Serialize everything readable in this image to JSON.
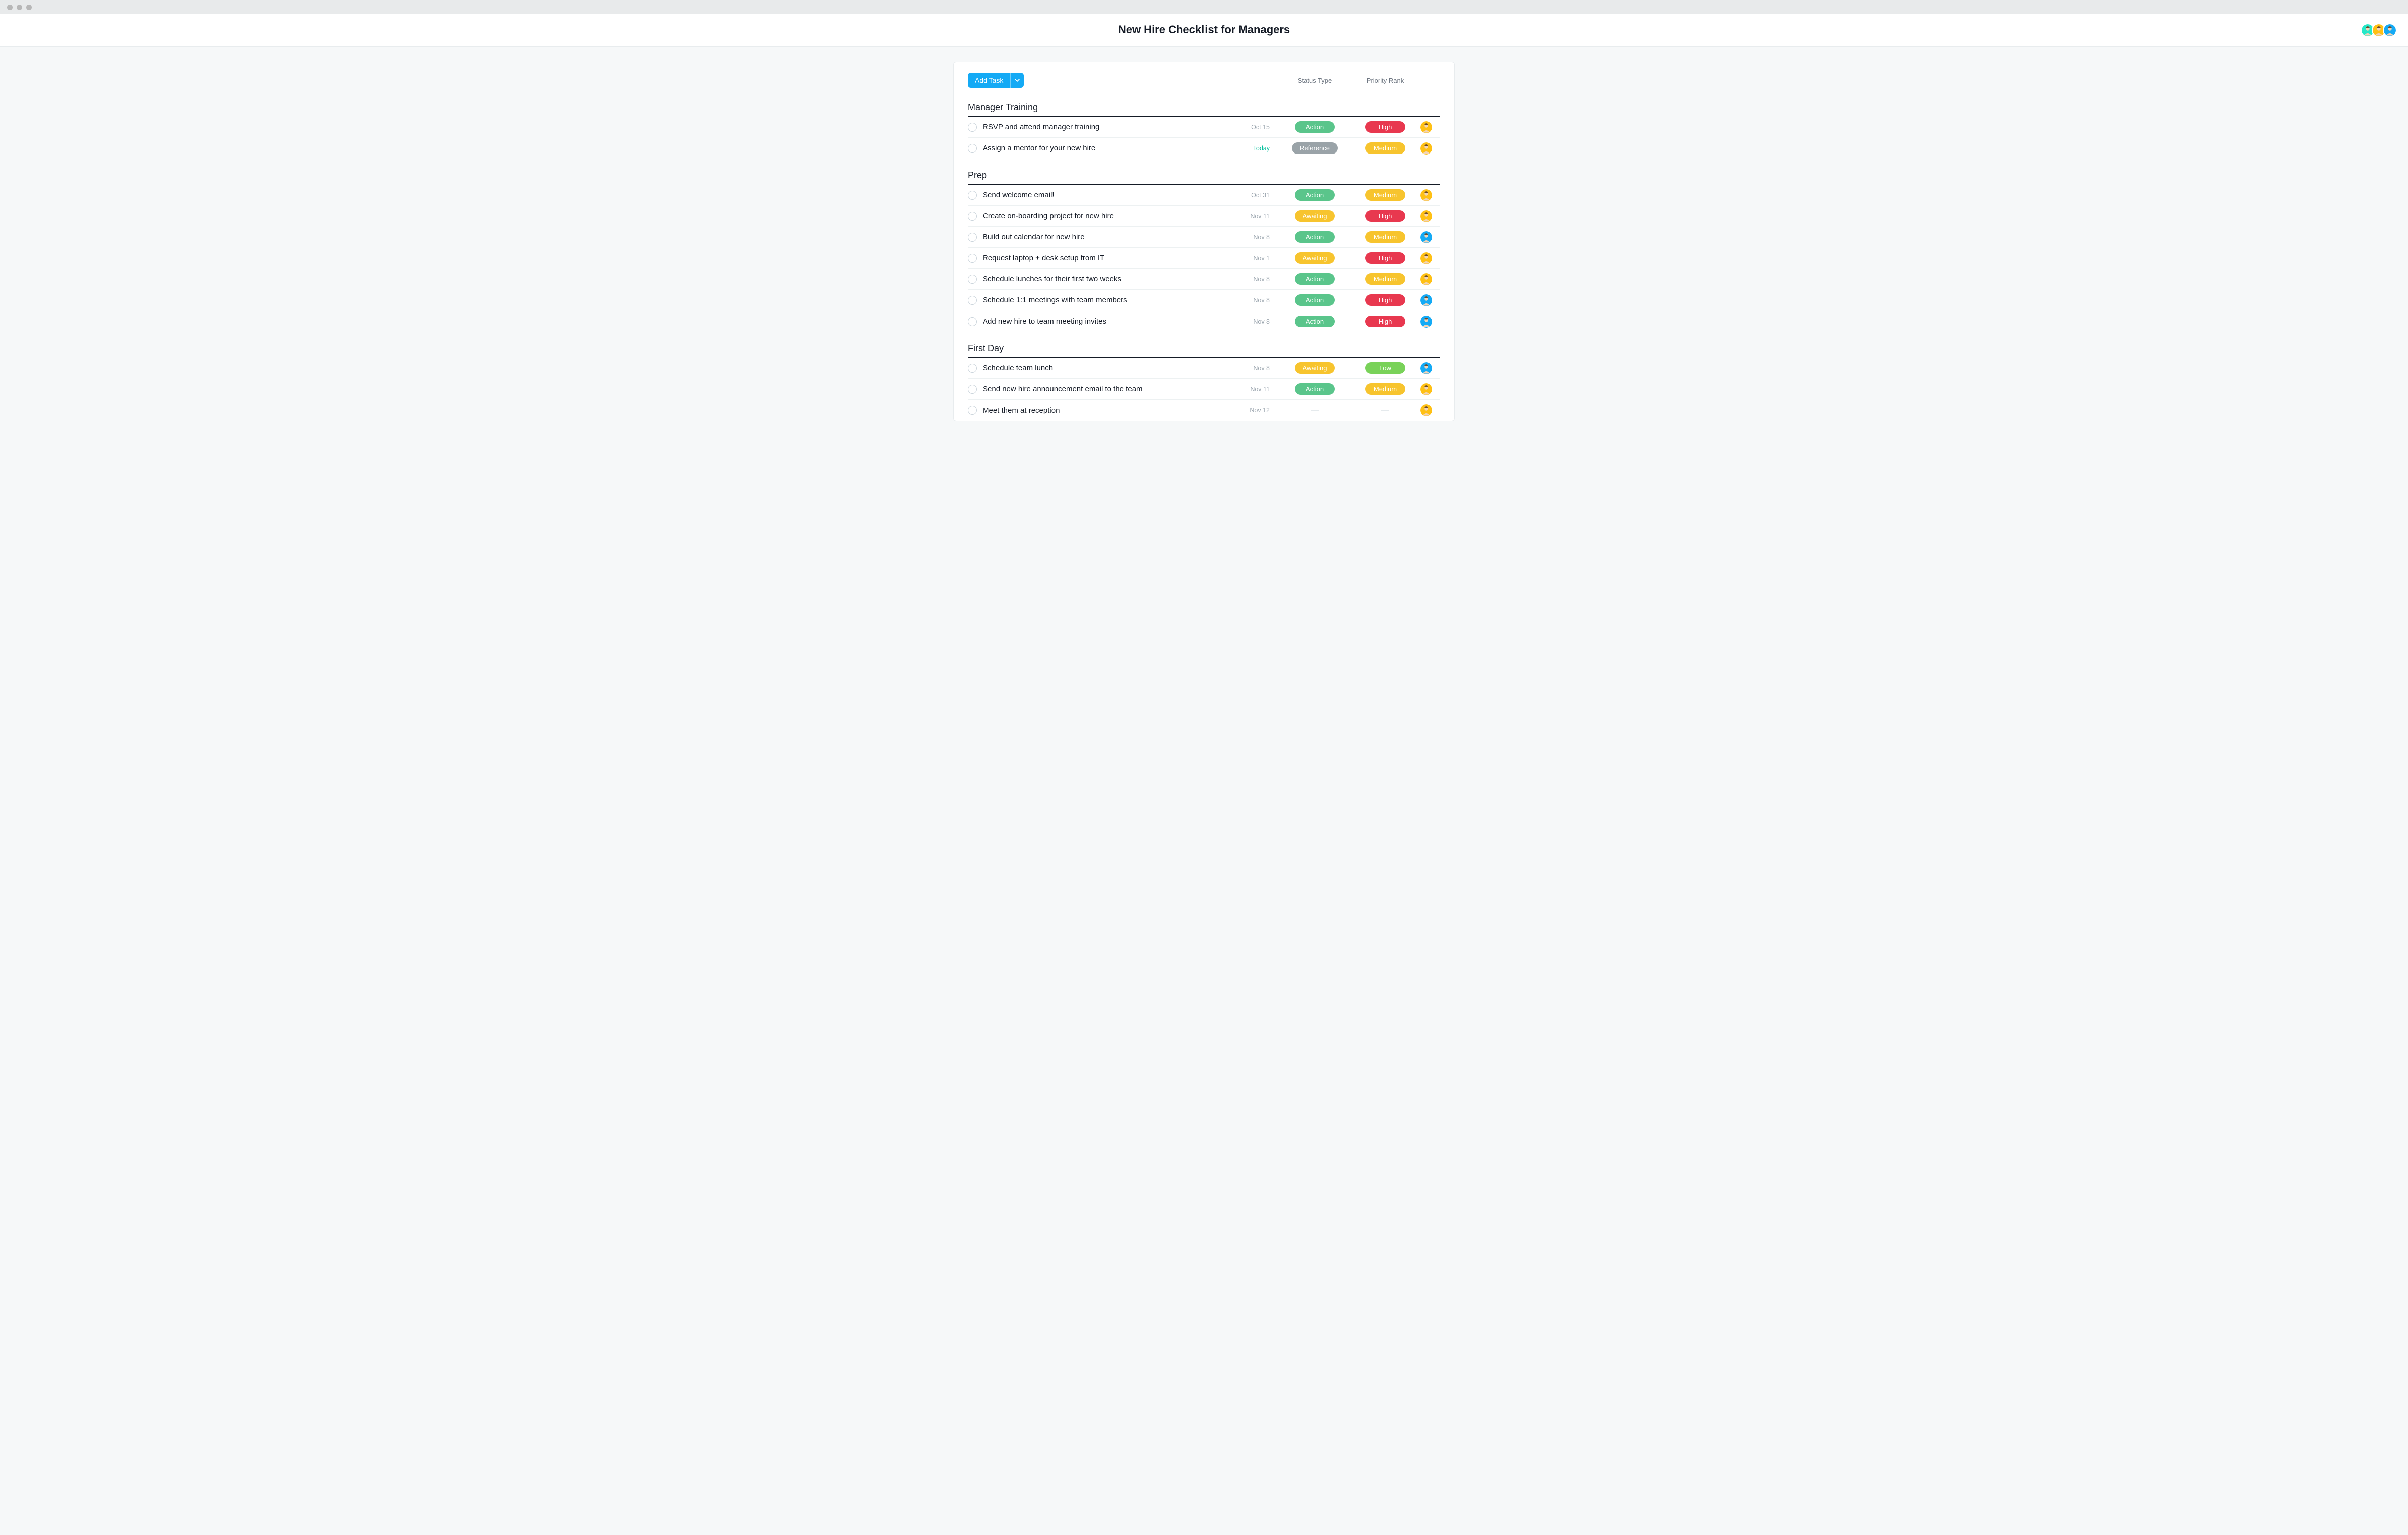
{
  "header": {
    "title": "New Hire Checklist for Managers"
  },
  "toolbar": {
    "add_task_label": "Add Task",
    "columns": {
      "status": "Status Type",
      "priority": "Priority Rank"
    }
  },
  "colors": {
    "status": {
      "Action": "#5ac58b",
      "Awaiting": "#f7c42e",
      "Reference": "#9aa3a8"
    },
    "priority": {
      "High": "#e8384f",
      "Medium": "#f7c42e",
      "Low": "#79d259"
    },
    "avatars": {
      "green": "#25e8c8",
      "yellow": "#ffc014",
      "blue": "#14aaf5"
    }
  },
  "avatars_header": [
    "green",
    "yellow",
    "blue"
  ],
  "sections": [
    {
      "title": "Manager Training",
      "tasks": [
        {
          "title": "RSVP and attend manager training",
          "date": "Oct 15",
          "today": false,
          "status": "Action",
          "priority": "High",
          "assignee": "yellow"
        },
        {
          "title": "Assign a mentor for your new hire",
          "date": "Today",
          "today": true,
          "status": "Reference",
          "priority": "Medium",
          "assignee": "yellow"
        }
      ]
    },
    {
      "title": "Prep",
      "tasks": [
        {
          "title": "Send welcome email!",
          "date": "Oct 31",
          "today": false,
          "status": "Action",
          "priority": "Medium",
          "assignee": "yellow"
        },
        {
          "title": "Create on-boarding project for new hire",
          "date": "Nov 11",
          "today": false,
          "status": "Awaiting",
          "priority": "High",
          "assignee": "yellow"
        },
        {
          "title": "Build out calendar for new hire",
          "date": "Nov 8",
          "today": false,
          "status": "Action",
          "priority": "Medium",
          "assignee": "blue"
        },
        {
          "title": "Request laptop + desk setup from IT",
          "date": "Nov 1",
          "today": false,
          "status": "Awaiting",
          "priority": "High",
          "assignee": "yellow"
        },
        {
          "title": "Schedule lunches for their first two weeks",
          "date": "Nov 8",
          "today": false,
          "status": "Action",
          "priority": "Medium",
          "assignee": "yellow"
        },
        {
          "title": "Schedule 1:1 meetings with team members",
          "date": "Nov 8",
          "today": false,
          "status": "Action",
          "priority": "High",
          "assignee": "blue"
        },
        {
          "title": "Add new hire to team meeting invites",
          "date": "Nov 8",
          "today": false,
          "status": "Action",
          "priority": "High",
          "assignee": "blue"
        }
      ]
    },
    {
      "title": "First Day",
      "tasks": [
        {
          "title": "Schedule team lunch",
          "date": "Nov 8",
          "today": false,
          "status": "Awaiting",
          "priority": "Low",
          "assignee": "blue"
        },
        {
          "title": "Send new hire announcement email to the team",
          "date": "Nov 11",
          "today": false,
          "status": "Action",
          "priority": "Medium",
          "assignee": "yellow"
        },
        {
          "title": "Meet them at reception",
          "date": "Nov 12",
          "today": false,
          "status": null,
          "priority": null,
          "assignee": "yellow"
        }
      ]
    }
  ]
}
